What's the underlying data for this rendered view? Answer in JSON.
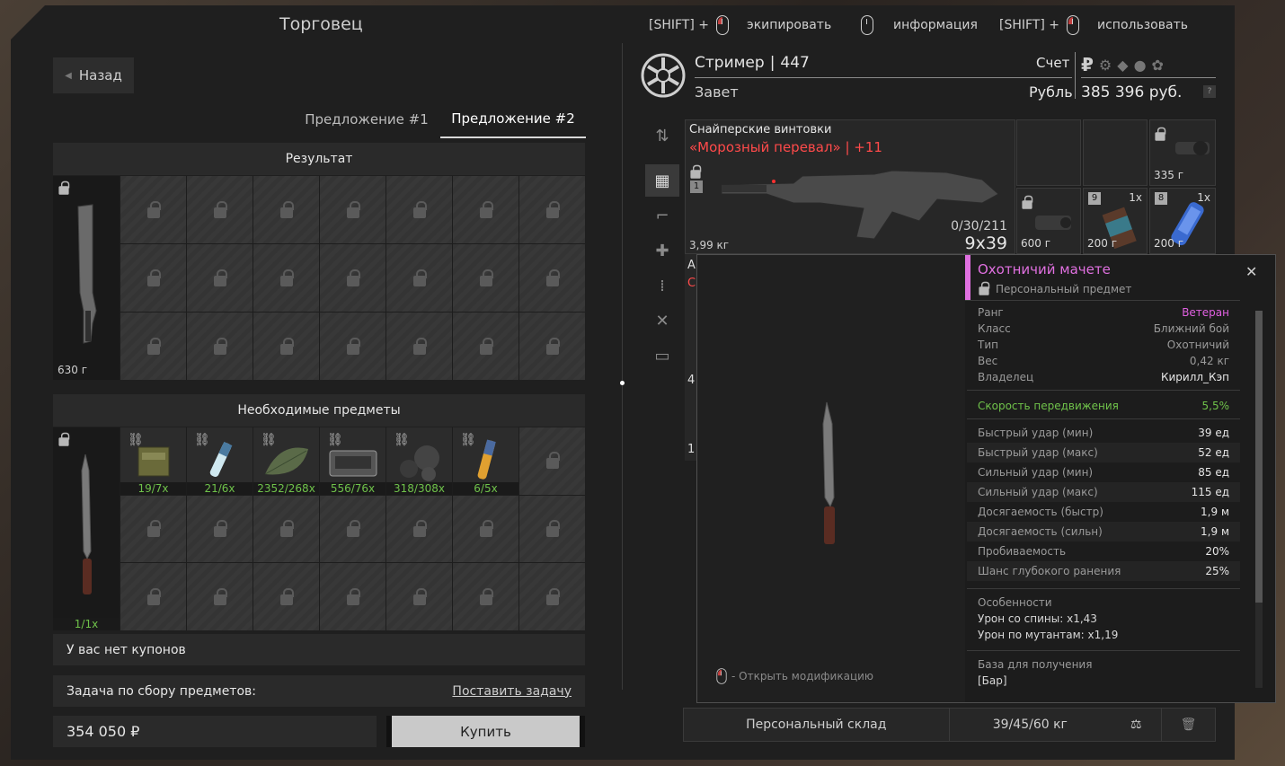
{
  "header": {
    "title": "Торговец",
    "hints": [
      {
        "prefix": "[SHIFT] +",
        "label": "экипировать"
      },
      {
        "prefix": "",
        "label": "информация"
      },
      {
        "prefix": "[SHIFT] +",
        "label": "использовать"
      }
    ]
  },
  "back_label": "Назад",
  "tabs": [
    "Предложение #1",
    "Предложение #2"
  ],
  "result": {
    "title": "Результат",
    "weight": "630 г"
  },
  "required": {
    "title": "Необходимые предметы",
    "main_qty": "1/1x",
    "items": [
      "19/7x",
      "21/6x",
      "2352/268x",
      "556/76x",
      "318/308x",
      "6/5x"
    ]
  },
  "coupons": "У вас нет купонов",
  "task": {
    "label": "Задача по сбору предметов:",
    "action": "Поставить задачу"
  },
  "price": "354 050 ₽",
  "buy_label": "Купить",
  "player": {
    "name": "Стример",
    "level": "447",
    "guild": "Завет",
    "account_label": "Счет",
    "currency_label": "Рубль",
    "balance": "385 396 руб.",
    "currency_symbol": "₽",
    "help": "?"
  },
  "inventory": {
    "category": "Снайперские винтовки",
    "weapon_name": "«Морозный перевал» | +11",
    "weight": "3,99 кг",
    "ammo": "0/30/211",
    "caliber": "9x39",
    "slot_badge": "1",
    "items": [
      {
        "weight": "335 г"
      },
      {
        "weight": "600 г"
      },
      {
        "weight": "200 г",
        "count": "1x",
        "badge": "9"
      },
      {
        "weight": "200 г",
        "count": "1x",
        "badge": "8"
      }
    ],
    "edge_letters": [
      "А",
      "С",
      "4",
      "1"
    ]
  },
  "tooltip": {
    "name": "Охотничий мачете",
    "personal": "Персональный предмет",
    "open_mod": "- Открыть модификацию",
    "info": [
      [
        "Ранг",
        "Ветеран"
      ],
      [
        "Класс",
        "Ближний бой"
      ],
      [
        "Тип",
        "Охотничий"
      ],
      [
        "Вес",
        "0,42 кг"
      ],
      [
        "Владелец",
        "Кирилл_Кэп"
      ]
    ],
    "bonus": [
      "Скорость передвижения",
      "5,5%"
    ],
    "stats": [
      [
        "Быстрый удар (мин)",
        "39 ед"
      ],
      [
        "Быстрый удар (макс)",
        "52 ед"
      ],
      [
        "Сильный удар (мин)",
        "85 ед"
      ],
      [
        "Сильный удар (макс)",
        "115 ед"
      ],
      [
        "Досягаемость (быстр)",
        "1,9 м"
      ],
      [
        "Досягаемость (сильн)",
        "1,9 м"
      ],
      [
        "Пробиваемость",
        "20%"
      ],
      [
        "Шанс глубокого ранения",
        "25%"
      ]
    ],
    "features_title": "Особенности",
    "features": [
      "Урон со спины: x1,43",
      "Урон по мутантам: x1,19"
    ],
    "base_title": "База для получения",
    "base_value": "[Бар]"
  },
  "footer": {
    "storage": "Персональный склад",
    "capacity": "39/45/60 кг"
  },
  "colors": {
    "rank": "#e060e0",
    "bonus": "#6fc24a",
    "weapon": "#ff4a4a",
    "name": "#e070e0"
  }
}
